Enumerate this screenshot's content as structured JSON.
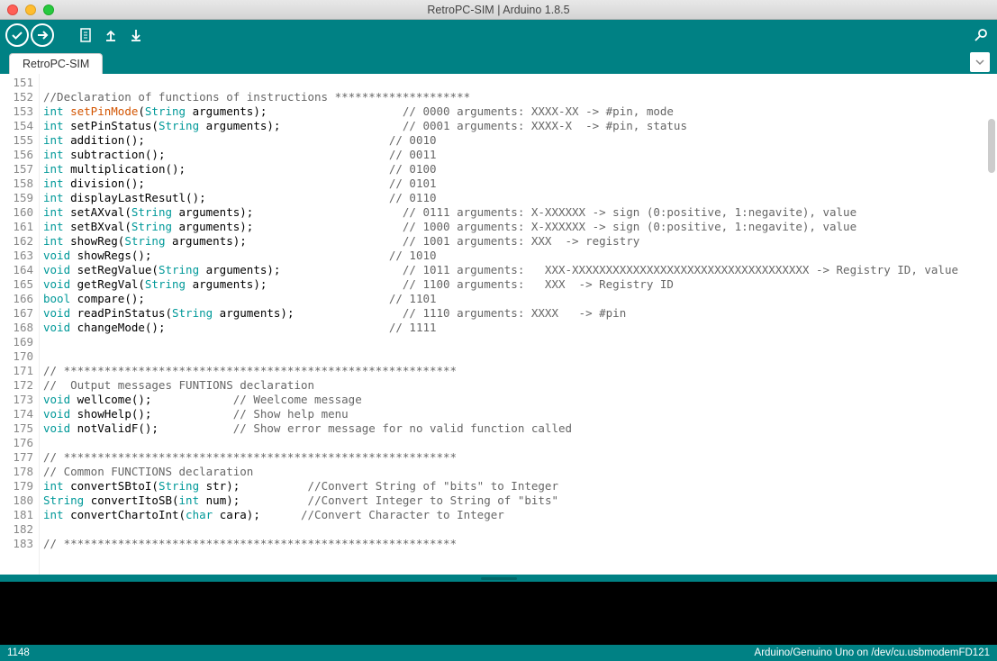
{
  "window": {
    "title": "RetroPC-SIM | Arduino 1.8.5"
  },
  "tab": {
    "label": "RetroPC-SIM"
  },
  "status": {
    "left": "1148",
    "right": "Arduino/Genuino Uno on /dev/cu.usbmodemFD121"
  },
  "gutter": {
    "start": 151,
    "end": 183
  },
  "code": [
    {
      "n": 151,
      "t": ""
    },
    {
      "n": 152,
      "t": "//Declaration of functions of instructions ********************",
      "cls": "cmt"
    },
    {
      "n": 153,
      "seg": [
        [
          "int ",
          "k-type"
        ],
        [
          "setPinMode",
          "k-fn"
        ],
        [
          "(",
          ""
        ],
        [
          "String",
          "k-str"
        ],
        [
          " arguments);",
          ""
        ],
        [
          "                    ",
          ""
        ],
        [
          "// 0000 arguments: XXXX-XX -> #pin, mode",
          "cmt"
        ]
      ]
    },
    {
      "n": 154,
      "seg": [
        [
          "int ",
          "k-type"
        ],
        [
          "setPinStatus(",
          ""
        ],
        [
          "String",
          "k-str"
        ],
        [
          " arguments);",
          ""
        ],
        [
          "                  ",
          ""
        ],
        [
          "// 0001 arguments: XXXX-X  -> #pin, status",
          "cmt"
        ]
      ]
    },
    {
      "n": 155,
      "seg": [
        [
          "int ",
          "k-type"
        ],
        [
          "addition();",
          ""
        ],
        [
          "                                    ",
          ""
        ],
        [
          "// 0010",
          "cmt"
        ]
      ]
    },
    {
      "n": 156,
      "seg": [
        [
          "int ",
          "k-type"
        ],
        [
          "subtraction();",
          ""
        ],
        [
          "                                 ",
          ""
        ],
        [
          "// 0011",
          "cmt"
        ]
      ]
    },
    {
      "n": 157,
      "seg": [
        [
          "int ",
          "k-type"
        ],
        [
          "multiplication();",
          ""
        ],
        [
          "                              ",
          ""
        ],
        [
          "// 0100",
          "cmt"
        ]
      ]
    },
    {
      "n": 158,
      "seg": [
        [
          "int ",
          "k-type"
        ],
        [
          "division();",
          ""
        ],
        [
          "                                    ",
          ""
        ],
        [
          "// 0101",
          "cmt"
        ]
      ]
    },
    {
      "n": 159,
      "seg": [
        [
          "int ",
          "k-type"
        ],
        [
          "displayLastResutl();",
          ""
        ],
        [
          "                           ",
          ""
        ],
        [
          "// 0110",
          "cmt"
        ]
      ]
    },
    {
      "n": 160,
      "seg": [
        [
          "int ",
          "k-type"
        ],
        [
          "setAXval(",
          ""
        ],
        [
          "String",
          "k-str"
        ],
        [
          " arguments);",
          ""
        ],
        [
          "                      ",
          ""
        ],
        [
          "// 0111 arguments: X-XXXXXX -> sign (0:positive, 1:negavite), value",
          "cmt"
        ]
      ]
    },
    {
      "n": 161,
      "seg": [
        [
          "int ",
          "k-type"
        ],
        [
          "setBXval(",
          ""
        ],
        [
          "String",
          "k-str"
        ],
        [
          " arguments);",
          ""
        ],
        [
          "                      ",
          ""
        ],
        [
          "// 1000 arguments: X-XXXXXX -> sign (0:positive, 1:negavite), value",
          "cmt"
        ]
      ]
    },
    {
      "n": 162,
      "seg": [
        [
          "int ",
          "k-type"
        ],
        [
          "showReg(",
          ""
        ],
        [
          "String",
          "k-str"
        ],
        [
          " arguments);",
          ""
        ],
        [
          "                       ",
          ""
        ],
        [
          "// 1001 arguments: XXX  -> registry",
          "cmt"
        ]
      ]
    },
    {
      "n": 163,
      "seg": [
        [
          "void ",
          "k-void"
        ],
        [
          "showRegs();",
          ""
        ],
        [
          "                                   ",
          ""
        ],
        [
          "// 1010",
          "cmt"
        ]
      ]
    },
    {
      "n": 164,
      "seg": [
        [
          "void ",
          "k-void"
        ],
        [
          "setRegValue(",
          ""
        ],
        [
          "String",
          "k-str"
        ],
        [
          " arguments);",
          ""
        ],
        [
          "                  ",
          ""
        ],
        [
          "// 1011 arguments:   XXX-XXXXXXXXXXXXXXXXXXXXXXXXXXXXXXXXXXX -> Registry ID, value",
          "cmt"
        ]
      ]
    },
    {
      "n": 165,
      "seg": [
        [
          "void ",
          "k-void"
        ],
        [
          "getRegVal(",
          ""
        ],
        [
          "String",
          "k-str"
        ],
        [
          " arguments);",
          ""
        ],
        [
          "                    ",
          ""
        ],
        [
          "// 1100 arguments:   XXX  -> Registry ID",
          "cmt"
        ]
      ]
    },
    {
      "n": 166,
      "seg": [
        [
          "bool ",
          "k-bool"
        ],
        [
          "compare();",
          ""
        ],
        [
          "                                    ",
          ""
        ],
        [
          "// 1101",
          "cmt"
        ]
      ]
    },
    {
      "n": 167,
      "seg": [
        [
          "void ",
          "k-void"
        ],
        [
          "readPinStatus(",
          ""
        ],
        [
          "String",
          "k-str"
        ],
        [
          " arguments);",
          ""
        ],
        [
          "                ",
          ""
        ],
        [
          "// 1110 arguments: XXXX   -> #pin",
          "cmt"
        ]
      ]
    },
    {
      "n": 168,
      "seg": [
        [
          "void ",
          "k-void"
        ],
        [
          "changeMode();",
          ""
        ],
        [
          "                                 ",
          ""
        ],
        [
          "// 1111",
          "cmt"
        ]
      ]
    },
    {
      "n": 169,
      "t": ""
    },
    {
      "n": 170,
      "t": ""
    },
    {
      "n": 171,
      "t": "// **********************************************************",
      "cls": "cmt"
    },
    {
      "n": 172,
      "t": "//  Output messages FUNTIONS declaration",
      "cls": "cmt"
    },
    {
      "n": 173,
      "seg": [
        [
          "void ",
          "k-void"
        ],
        [
          "wellcome();",
          ""
        ],
        [
          "            ",
          ""
        ],
        [
          "// Weelcome message",
          "cmt"
        ]
      ]
    },
    {
      "n": 174,
      "seg": [
        [
          "void ",
          "k-void"
        ],
        [
          "showHelp();",
          ""
        ],
        [
          "            ",
          ""
        ],
        [
          "// Show help menu",
          "cmt"
        ]
      ]
    },
    {
      "n": 175,
      "seg": [
        [
          "void ",
          "k-void"
        ],
        [
          "notValidF();",
          ""
        ],
        [
          "           ",
          ""
        ],
        [
          "// Show error message for no valid function called",
          "cmt"
        ]
      ]
    },
    {
      "n": 176,
      "t": ""
    },
    {
      "n": 177,
      "t": "// **********************************************************",
      "cls": "cmt"
    },
    {
      "n": 178,
      "t": "// Common FUNCTIONS declaration",
      "cls": "cmt"
    },
    {
      "n": 179,
      "seg": [
        [
          "int ",
          "k-type"
        ],
        [
          "convertSBtoI(",
          ""
        ],
        [
          "String",
          "k-str"
        ],
        [
          " str);",
          ""
        ],
        [
          "          ",
          ""
        ],
        [
          "//Convert String of \"bits\" to Integer",
          "cmt"
        ]
      ]
    },
    {
      "n": 180,
      "seg": [
        [
          "String ",
          "k-str"
        ],
        [
          "convertItoSB(",
          ""
        ],
        [
          "int ",
          "k-type"
        ],
        [
          "num);",
          ""
        ],
        [
          "          ",
          ""
        ],
        [
          "//Convert Integer to String of \"bits\"",
          "cmt"
        ]
      ]
    },
    {
      "n": 181,
      "seg": [
        [
          "int ",
          "k-type"
        ],
        [
          "convertChartoInt(",
          ""
        ],
        [
          "char ",
          "k-type"
        ],
        [
          "cara);",
          ""
        ],
        [
          "      ",
          ""
        ],
        [
          "//Convert Character to Integer",
          "cmt"
        ]
      ]
    },
    {
      "n": 182,
      "t": ""
    },
    {
      "n": 183,
      "t": "// **********************************************************",
      "cls": "cmt"
    }
  ]
}
